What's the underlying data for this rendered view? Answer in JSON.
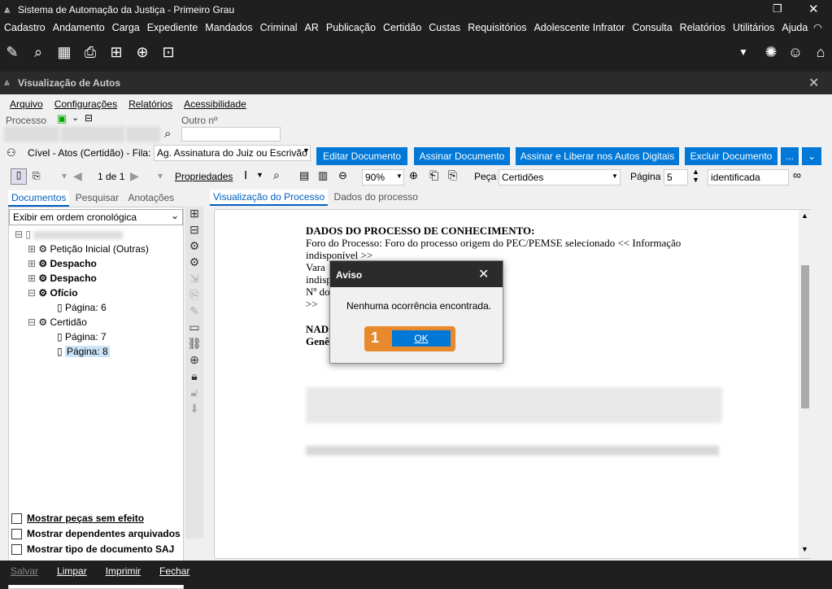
{
  "app_title": "Sistema de Automação da Justiça - Primeiro Grau",
  "main_menu": [
    "Cadastro",
    "Andamento",
    "Carga",
    "Expediente",
    "Mandados",
    "Criminal",
    "AR",
    "Publicação",
    "Certidão",
    "Custas",
    "Requisitórios",
    "Adolescente Infrator",
    "Consulta",
    "Relatórios",
    "Utilitários",
    "Ajuda"
  ],
  "window_title": "Visualização de Autos",
  "autos_menu": [
    "Arquivo",
    "Configurações",
    "Relatórios",
    "Acessibilidade"
  ],
  "processo_label": "Processo",
  "outro_label": "Outro nº",
  "fila_label": "Cível - Atos (Certidão) - Fila:",
  "fila_value": "Ag. Assinatura do Juiz ou Escrivão",
  "buttons": {
    "editar": "Editar Documento",
    "assinar": "Assinar Documento",
    "assinar_liberar": "Assinar e Liberar nos Autos Digitais",
    "excluir": "Excluir Documento",
    "more": "..."
  },
  "viewer": {
    "page_counter": "1 de 1",
    "propriedades": "Propriedades",
    "zoom": "90%",
    "peca_label": "Peça",
    "peca_value": "Certidões",
    "pagina_label": "Página",
    "pagina_value": "5",
    "search_value": "identificada"
  },
  "left_tabs": [
    "Documentos",
    "Pesquisar",
    "Anotações"
  ],
  "order_select": "Exibir em ordem cronológica",
  "tree": [
    {
      "label": "Petição Inicial (Outras)",
      "bold": false
    },
    {
      "label": "Despacho",
      "bold": true
    },
    {
      "label": "Despacho",
      "bold": true
    },
    {
      "label": "Ofício",
      "bold": true
    },
    {
      "label": "Página: 6",
      "bold": false
    },
    {
      "label": "Certidão",
      "bold": false
    },
    {
      "label": "Página: 7",
      "bold": false
    },
    {
      "label": "Página: 8",
      "bold": false
    }
  ],
  "checkboxes": [
    "Mostrar peças sem efeito",
    "Mostrar dependentes arquivados",
    "Mostrar tipo de documento SAJ"
  ],
  "doc_tabs": [
    "Visualização do Processo",
    "Dados do processo"
  ],
  "document": {
    "heading": "DADOS DO PROCESSO DE CONHECIMENTO:",
    "line1": "Foro do Processo: Foro do processo origem do PEC/PEMSE selecionado << Informação",
    "line2": "indisponível >>",
    "line3": "Vara",
    "line4": "indisp",
    "line5": "Nº do",
    "line6": ">>",
    "line7": "NAD",
    "line8": "Genê"
  },
  "dialog": {
    "title": "Aviso",
    "message": "Nenhuma ocorrência encontrada.",
    "ok": "OK",
    "step": "1"
  },
  "bottom_buttons": [
    "Salvar",
    "Limpar",
    "Imprimir",
    "Fechar"
  ]
}
